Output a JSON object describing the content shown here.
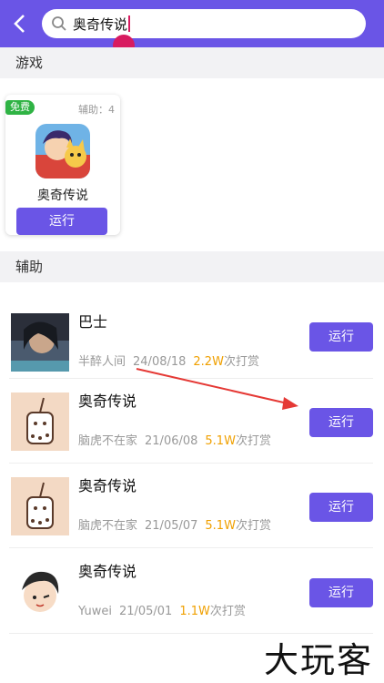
{
  "search": {
    "query": "奥奇传说"
  },
  "sections": {
    "games": "游戏",
    "assist": "辅助"
  },
  "game_card": {
    "badge": "免费",
    "assist_count": "辅助：4",
    "name": "奥奇传说",
    "run_label": "运行"
  },
  "assist_list": [
    {
      "title": "巴士",
      "author": "半醉人间",
      "date": "24/08/18",
      "count": "2.2W",
      "suffix": "次打赏",
      "run_label": "运行"
    },
    {
      "title": "奥奇传说",
      "author": "脑虎不在家",
      "date": "21/06/08",
      "count": "5.1W",
      "suffix": "次打赏",
      "run_label": "运行"
    },
    {
      "title": "奥奇传说",
      "author": "脑虎不在家",
      "date": "21/05/07",
      "count": "5.1W",
      "suffix": "次打赏",
      "run_label": "运行"
    },
    {
      "title": "奥奇传说",
      "author": "Yuwei",
      "date": "21/05/01",
      "count": "1.1W",
      "suffix": "次打赏",
      "run_label": "运行"
    }
  ],
  "watermark": "大玩客",
  "colors": {
    "accent": "#6a55e6",
    "free": "#2fb344",
    "count": "#f0a000",
    "annotation": "#e53935"
  }
}
